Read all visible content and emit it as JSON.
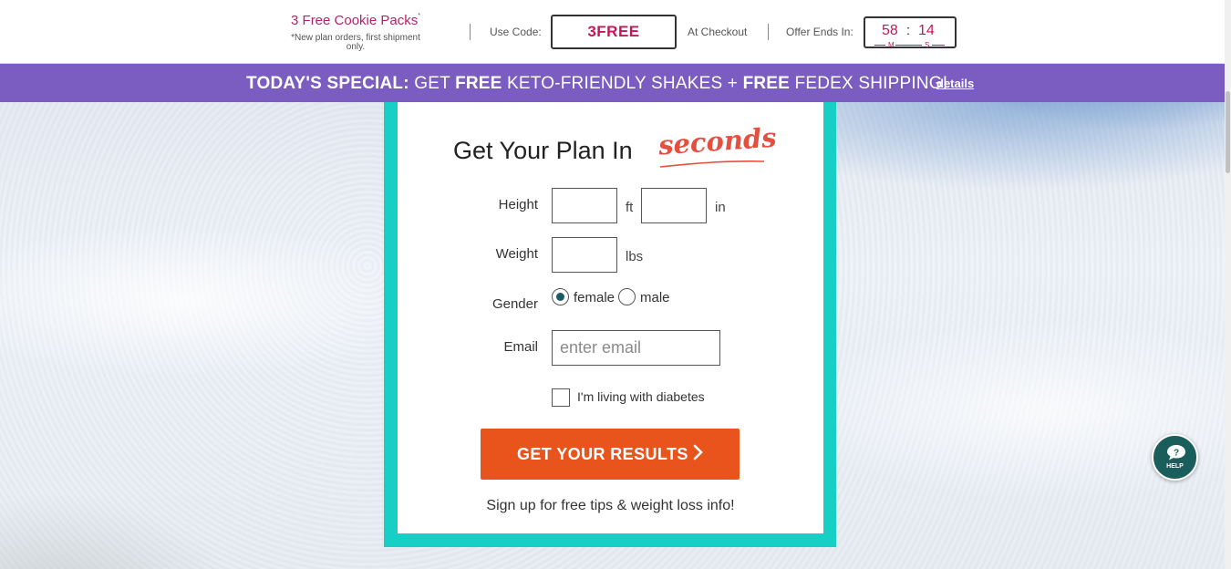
{
  "topbar": {
    "promo_title": "3 Free Cookie Packs",
    "promo_asterisk": "*",
    "promo_note": "*New plan orders, first shipment only.",
    "use_code_label": "Use Code:",
    "code": "3FREE",
    "at_checkout_label": "At Checkout",
    "offer_ends_label": "Offer Ends In:",
    "timer": {
      "minutes": "58",
      "separator": ":",
      "seconds": "14",
      "minutes_unit": "M",
      "seconds_unit": "S"
    }
  },
  "special_banner": {
    "lead": "TODAY'S SPECIAL:",
    "get": "GET",
    "free1": "FREE",
    "middle": "KETO-FRIENDLY SHAKES +",
    "free2": "FREE",
    "end": "FEDEX SHIPPING!",
    "details_link": "details",
    "color": "#7b5cc1"
  },
  "form": {
    "title": "Get Your Plan In",
    "title_accent": "seconds",
    "height_label": "Height",
    "height_ft_unit": "ft",
    "height_in_unit": "in",
    "height_ft_value": "",
    "height_in_value": "",
    "weight_label": "Weight",
    "weight_unit": "lbs",
    "weight_value": "",
    "gender_label": "Gender",
    "gender_options": [
      "female",
      "male"
    ],
    "gender_selected": "female",
    "email_label": "Email",
    "email_placeholder": "enter email",
    "email_value": "",
    "diabetes_label": "I'm living with diabetes",
    "diabetes_checked": false,
    "submit_label": "GET YOUR RESULTS",
    "submit_icon": "chevron-right-icon",
    "signup_note": "Sign up for free tips & weight loss info!",
    "frame_color": "#18cfc5",
    "cta_color": "#e8541b"
  },
  "help": {
    "label": "HELP",
    "icon": "chat-question-icon"
  }
}
